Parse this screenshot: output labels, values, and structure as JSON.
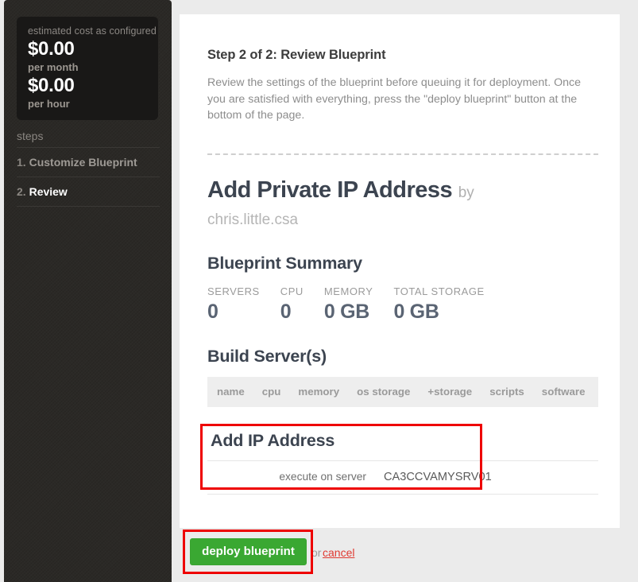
{
  "sidebar": {
    "cost_box": {
      "caption": "estimated cost as configured",
      "monthly_amount": "$0.00",
      "monthly_unit": "per month",
      "hourly_amount": "$0.00",
      "hourly_unit": "per hour"
    },
    "steps_label": "steps",
    "steps": [
      {
        "num": "1.",
        "label": "Customize Blueprint",
        "active": false
      },
      {
        "num": "2.",
        "label": "Review",
        "active": true
      }
    ]
  },
  "main": {
    "step_heading": "Step 2 of 2: Review Blueprint",
    "step_description": "Review the settings of the blueprint before queuing it for deployment. Once you are satisfied with everything, press the \"deploy blueprint\" button at the bottom of the page.",
    "blueprint_title": "Add Private IP Address",
    "by_word": "by",
    "author": "chris.little.csa",
    "summary": {
      "heading": "Blueprint Summary",
      "stats": [
        {
          "label": "SERVERS",
          "value": "0"
        },
        {
          "label": "CPU",
          "value": "0"
        },
        {
          "label": "MEMORY",
          "value": "0 GB"
        },
        {
          "label": "TOTAL STORAGE",
          "value": "0 GB"
        }
      ]
    },
    "build_servers": {
      "heading": "Build Server(s)",
      "columns": [
        "name",
        "cpu",
        "memory",
        "os storage",
        "+storage",
        "scripts",
        "software"
      ],
      "rows": []
    },
    "add_ip_address": {
      "heading": "Add IP Address",
      "params": [
        {
          "label": "execute on server",
          "value": "CA3CCVAMYSRV01"
        }
      ]
    }
  },
  "footer": {
    "deploy_label": "deploy blueprint",
    "or_text": "or",
    "cancel_label": "cancel"
  },
  "colors": {
    "accent_green": "#3aa832",
    "highlight_red": "#ee0000",
    "cancel_red": "#e03a32",
    "sidebar_dark": "#2b2926",
    "page_bg": "#ebebeb"
  }
}
